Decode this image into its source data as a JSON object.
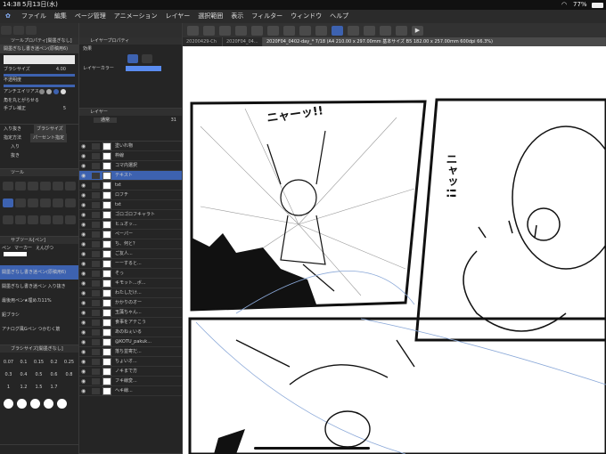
{
  "status": {
    "time": "14:38",
    "date": "5月13日(水)",
    "battery": "77%"
  },
  "menu": [
    "ファイル",
    "編集",
    "ページ管理",
    "アニメーション",
    "レイヤー",
    "選択範囲",
    "表示",
    "フィルター",
    "ウィンドウ",
    "ヘルプ"
  ],
  "tabs": [
    {
      "label": "20200429-Ch"
    },
    {
      "label": "2020F04_04..."
    },
    {
      "label": "2020F04_0402-day_* 7/18 (A4 210.00 x 297.00mm 基本サイズ B5 182.00 x 257.00mm 600dpi 66.3%)"
    }
  ],
  "tool_property": {
    "title": "ツールプロパティ[開墨ぎなし]",
    "brush_name": "開墨ぎなし書き迷ペン(原稿用6)",
    "brush_size_label": "ブラシサイズ",
    "brush_size_value": "4.00",
    "opacity_label": "不透明度",
    "antialias_label": "アンチエイリアス",
    "corner_label": "角を丸とがらせる",
    "stabilize_label": "手ブレ補正",
    "stabilize_value": "5"
  },
  "brush_size_panel": {
    "input_label": "入り抜き",
    "mode": "ブラシサイズ",
    "spec_label": "指定方法",
    "percent": "パーセント指定",
    "in_label": "入り",
    "out_label": "抜き"
  },
  "tool_palette": {
    "title": "ツール"
  },
  "sub_tool": {
    "title": "サブツール[ペン]",
    "tabs": [
      "ペン",
      "マーカー",
      "えんぴつ"
    ],
    "items": [
      "開墨ぎなし書き迷ペン(原稿用6)",
      "開墨ぎなし書き迷ペン 入り抜き",
      "最後用ペン★埋めカ11%",
      "鉛ブラシ",
      "アナログ風Gペン つかむく筋"
    ]
  },
  "brush_size_list": {
    "title": "ブラシサイズ[開墨ぎなし]",
    "sizes": [
      "0.07",
      "0.1",
      "0.15",
      "0.2",
      "0.25",
      "0.3",
      "0.4",
      "0.5",
      "0.6",
      "0.8",
      "1",
      "1.2",
      "1.5",
      "1.7"
    ]
  },
  "layer_property": {
    "title": "レイヤープロパティ",
    "effect_label": "効果",
    "color_label": "レイヤーカラー"
  },
  "layer_panel": {
    "title": "レイヤー",
    "blend_mode": "通常",
    "opacity": "31",
    "layers": [
      "塗いれ物",
      "枠線",
      "コマ内選択",
      "テキスト",
      "txt",
      "ロフチ",
      "txt",
      "ゴロゴロフキャラト",
      "ヒュオッ...",
      "ペーパー",
      "ち、何と？",
      "ご友人...",
      "ーーすると...",
      "そっ",
      "キモット...ボ...",
      "わたしだけ...",
      "かかりのオー",
      "玉藻ちゃん...",
      "食事をアテこう",
      "あのねぇいる",
      "@KOTU_pakuk...",
      "落ち並寄だ...",
      "ちょいオ...",
      "ノキまで方",
      "フキ線変...",
      "ヘキ線..."
    ]
  },
  "manga": {
    "shout_left": "ニャーッ!!",
    "shout_right": "ニャッ!!"
  },
  "colors": {
    "accent": "#3d62b0",
    "bg": "#1e1e1e",
    "panel": "#252525"
  }
}
